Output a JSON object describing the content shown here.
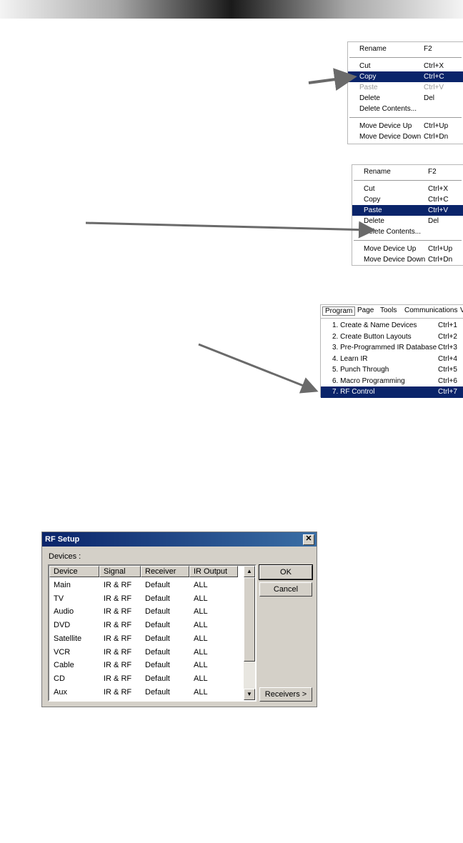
{
  "menu1": {
    "items": [
      {
        "label": "Rename",
        "shortcut": "F2"
      },
      {
        "label": "Cut",
        "shortcut": "Ctrl+X"
      },
      {
        "label": "Copy",
        "shortcut": "Ctrl+C"
      },
      {
        "label": "Paste",
        "shortcut": "Ctrl+V"
      },
      {
        "label": "Delete",
        "shortcut": "Del"
      },
      {
        "label": "Delete Contents...",
        "shortcut": ""
      },
      {
        "label": "Move Device Up",
        "shortcut": "Ctrl+Up"
      },
      {
        "label": "Move Device Down",
        "shortcut": "Ctrl+Dn"
      }
    ]
  },
  "menu2": {
    "items": [
      {
        "label": "Rename",
        "shortcut": "F2"
      },
      {
        "label": "Cut",
        "shortcut": "Ctrl+X"
      },
      {
        "label": "Copy",
        "shortcut": "Ctrl+C"
      },
      {
        "label": "Paste",
        "shortcut": "Ctrl+V"
      },
      {
        "label": "Delete",
        "shortcut": "Del"
      },
      {
        "label": "Delete Contents...",
        "shortcut": ""
      },
      {
        "label": "Move Device Up",
        "shortcut": "Ctrl+Up"
      },
      {
        "label": "Move Device Down",
        "shortcut": "Ctrl+Dn"
      }
    ]
  },
  "menu3": {
    "menubar": [
      "Program",
      "Page",
      "Tools",
      "Communications",
      "V"
    ],
    "items": [
      {
        "label": "1. Create & Name Devices",
        "shortcut": "Ctrl+1"
      },
      {
        "label": "2. Create Button Layouts",
        "shortcut": "Ctrl+2"
      },
      {
        "label": "3. Pre-Programmed IR Database",
        "shortcut": "Ctrl+3"
      },
      {
        "label": "4. Learn IR",
        "shortcut": "Ctrl+4"
      },
      {
        "label": "5. Punch Through",
        "shortcut": "Ctrl+5"
      },
      {
        "label": "6. Macro Programming",
        "shortcut": "Ctrl+6"
      },
      {
        "label": "7. RF Control",
        "shortcut": "Ctrl+7"
      }
    ]
  },
  "dialog": {
    "title": "RF Setup",
    "close_glyph": "✕",
    "devices_label": "Devices :",
    "columns": [
      "Device",
      "Signal",
      "Receiver",
      "IR Output"
    ],
    "rows": [
      [
        "Main",
        "IR & RF",
        "Default",
        "ALL"
      ],
      [
        "TV",
        "IR & RF",
        "Default",
        "ALL"
      ],
      [
        "Audio",
        "IR & RF",
        "Default",
        "ALL"
      ],
      [
        "DVD",
        "IR & RF",
        "Default",
        "ALL"
      ],
      [
        "Satellite",
        "IR & RF",
        "Default",
        "ALL"
      ],
      [
        "VCR",
        "IR & RF",
        "Default",
        "ALL"
      ],
      [
        "Cable",
        "IR & RF",
        "Default",
        "ALL"
      ],
      [
        "CD",
        "IR & RF",
        "Default",
        "ALL"
      ],
      [
        "Aux",
        "IR & RF",
        "Default",
        "ALL"
      ]
    ],
    "ok_label": "OK",
    "cancel_label": "Cancel",
    "receivers_label": "Receivers >",
    "scroll_up_glyph": "▲",
    "scroll_down_glyph": "▼"
  },
  "colors": {
    "highlight": "#0a246a",
    "arrow": "#6a6a6a",
    "dialog_bg": "#d4d0c8"
  }
}
